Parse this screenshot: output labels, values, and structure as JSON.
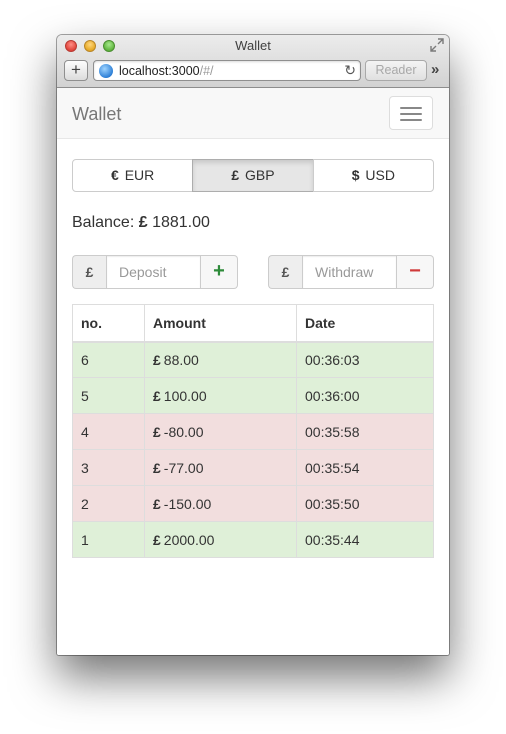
{
  "window": {
    "title": "Wallet",
    "url_host": "localhost:3000",
    "url_path": "/#/",
    "reader_label": "Reader",
    "add_tab_label": "+",
    "reload_glyph": "↻",
    "more_glyph": "»"
  },
  "navbar": {
    "brand": "Wallet"
  },
  "currencies": [
    {
      "symbol": "€",
      "code": "EUR",
      "active": false
    },
    {
      "symbol": "£",
      "code": "GBP",
      "active": true
    },
    {
      "symbol": "$",
      "code": "USD",
      "active": false
    }
  ],
  "balance": {
    "label": "Balance:",
    "symbol": "£",
    "amount": "1881.00"
  },
  "deposit": {
    "currency_symbol": "£",
    "placeholder": "Deposit",
    "button_glyph": "+"
  },
  "withdraw": {
    "currency_symbol": "£",
    "placeholder": "Withdraw",
    "button_glyph": "−"
  },
  "table": {
    "headers": {
      "no": "no.",
      "amount": "Amount",
      "date": "Date"
    },
    "rows": [
      {
        "no": "6",
        "symbol": "£",
        "amount": "88.00",
        "date": "00:36:03",
        "type": "positive"
      },
      {
        "no": "5",
        "symbol": "£",
        "amount": "100.00",
        "date": "00:36:00",
        "type": "positive"
      },
      {
        "no": "4",
        "symbol": "£",
        "amount": "-80.00",
        "date": "00:35:58",
        "type": "negative"
      },
      {
        "no": "3",
        "symbol": "£",
        "amount": "-77.00",
        "date": "00:35:54",
        "type": "negative"
      },
      {
        "no": "2",
        "symbol": "£",
        "amount": "-150.00",
        "date": "00:35:50",
        "type": "negative"
      },
      {
        "no": "1",
        "symbol": "£",
        "amount": "2000.00",
        "date": "00:35:44",
        "type": "positive"
      }
    ]
  },
  "colors": {
    "positive_row": "#dff0d8",
    "negative_row": "#f2dede",
    "plus": "#2e8b3a",
    "minus": "#d03a3a"
  }
}
